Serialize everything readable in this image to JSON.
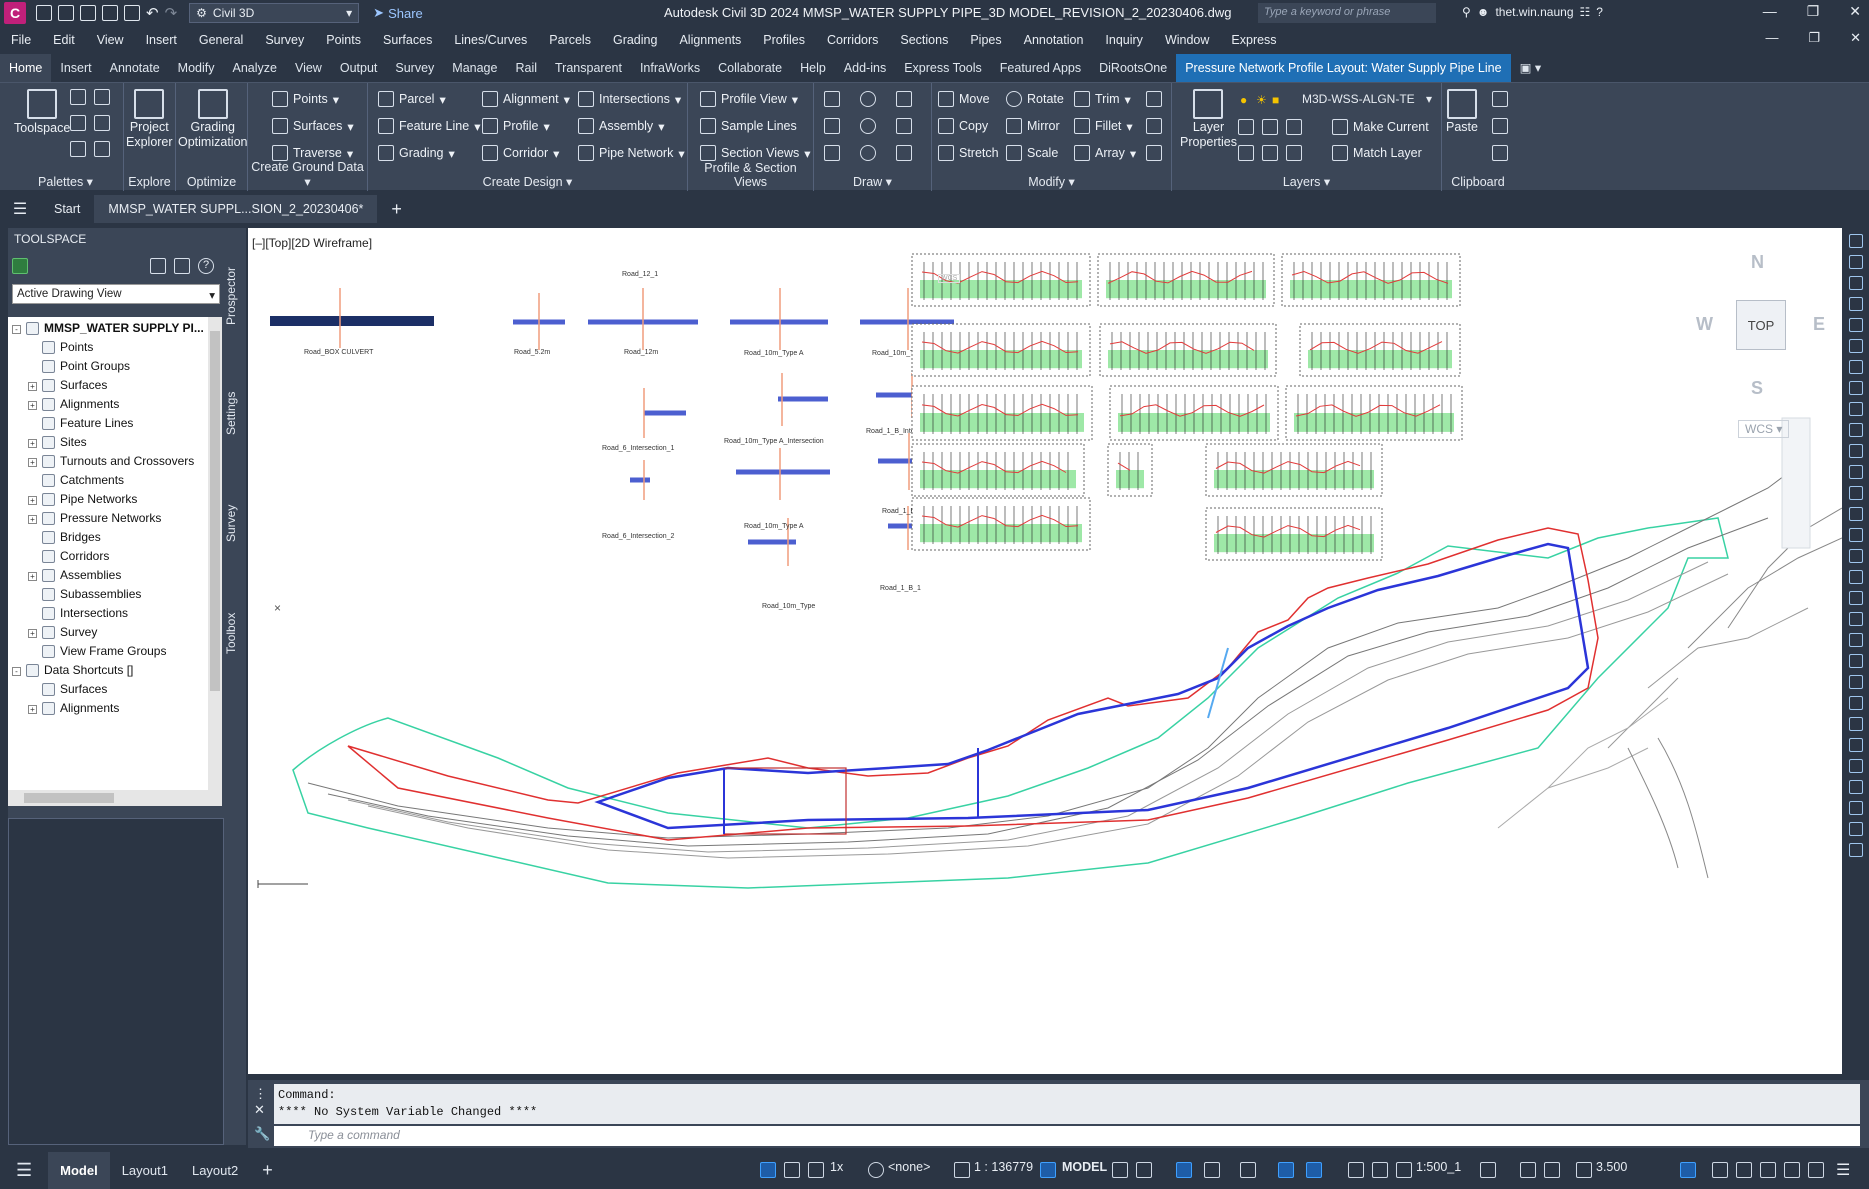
{
  "titlebar": {
    "app_logo": "C",
    "workspace": "Civil 3D",
    "share": "Share",
    "title": "Autodesk Civil 3D 2024   MMSP_WATER SUPPLY PIPE_3D MODEL_REVISION_2_20230406.dwg",
    "search_placeholder": "Type a keyword or phrase",
    "user": "thet.win.naung"
  },
  "menubar": [
    "File",
    "Edit",
    "View",
    "Insert",
    "General",
    "Survey",
    "Points",
    "Surfaces",
    "Lines/Curves",
    "Parcels",
    "Grading",
    "Alignments",
    "Profiles",
    "Corridors",
    "Sections",
    "Pipes",
    "Annotation",
    "Inquiry",
    "Window",
    "Express"
  ],
  "ribbon_tabs": [
    "Home",
    "Insert",
    "Annotate",
    "Modify",
    "Analyze",
    "View",
    "Output",
    "Survey",
    "Manage",
    "Rail",
    "Transparent",
    "InfraWorks",
    "Collaborate",
    "Help",
    "Add-ins",
    "Express Tools",
    "Featured Apps",
    "DiRootsOne"
  ],
  "ribbon_context_tab": "Pressure Network Profile Layout: Water Supply Pipe Line",
  "ribbon": {
    "palettes": {
      "title": "Palettes",
      "toolspace": "Toolspace"
    },
    "explore": {
      "title": "Explore",
      "project_explorer_1": "Project",
      "project_explorer_2": "Explorer"
    },
    "optimize": {
      "title": "Optimize",
      "grading_1": "Grading",
      "grading_2": "Optimization"
    },
    "ground": {
      "title": "Create Ground Data",
      "points": "Points",
      "surfaces": "Surfaces",
      "traverse": "Traverse"
    },
    "design": {
      "title": "Create Design",
      "parcel": "Parcel",
      "feature_line": "Feature Line",
      "grading": "Grading",
      "alignment": "Alignment",
      "profile": "Profile",
      "corridor": "Corridor",
      "intersections": "Intersections",
      "assembly": "Assembly",
      "pipe_network": "Pipe Network"
    },
    "profile_section": {
      "title": "Profile & Section Views",
      "profile_view": "Profile View",
      "sample_lines": "Sample Lines",
      "section_views": "Section Views"
    },
    "draw": {
      "title": "Draw"
    },
    "modify": {
      "title": "Modify",
      "move": "Move",
      "copy": "Copy",
      "stretch": "Stretch",
      "rotate": "Rotate",
      "mirror": "Mirror",
      "scale": "Scale",
      "trim": "Trim",
      "fillet": "Fillet",
      "array": "Array"
    },
    "layers": {
      "title": "Layers",
      "layer_props_1": "Layer",
      "layer_props_2": "Properties",
      "current_layer": "M3D-WSS-ALGN-TE",
      "make_current": "Make Current",
      "match_layer": "Match Layer"
    },
    "clipboard": {
      "title": "Clipboard",
      "paste": "Paste"
    }
  },
  "file_tabs": {
    "start": "Start",
    "doc": "MMSP_WATER SUPPL...SION_2_20230406*"
  },
  "toolspace": {
    "title": "TOOLSPACE",
    "view_select": "Active Drawing View",
    "tree": [
      {
        "label": "MMSP_WATER SUPPLY PI...",
        "level": 0,
        "exp": "-",
        "bold": true
      },
      {
        "label": "Points",
        "level": 1,
        "exp": ""
      },
      {
        "label": "Point Groups",
        "level": 1,
        "exp": ""
      },
      {
        "label": "Surfaces",
        "level": 1,
        "exp": "+"
      },
      {
        "label": "Alignments",
        "level": 1,
        "exp": "+"
      },
      {
        "label": "Feature Lines",
        "level": 1,
        "exp": ""
      },
      {
        "label": "Sites",
        "level": 1,
        "exp": "+"
      },
      {
        "label": "Turnouts and Crossovers",
        "level": 1,
        "exp": "+"
      },
      {
        "label": "Catchments",
        "level": 1,
        "exp": ""
      },
      {
        "label": "Pipe Networks",
        "level": 1,
        "exp": "+"
      },
      {
        "label": "Pressure Networks",
        "level": 1,
        "exp": "+"
      },
      {
        "label": "Bridges",
        "level": 1,
        "exp": ""
      },
      {
        "label": "Corridors",
        "level": 1,
        "exp": ""
      },
      {
        "label": "Assemblies",
        "level": 1,
        "exp": "+"
      },
      {
        "label": "Subassemblies",
        "level": 1,
        "exp": ""
      },
      {
        "label": "Intersections",
        "level": 1,
        "exp": ""
      },
      {
        "label": "Survey",
        "level": 1,
        "exp": "+"
      },
      {
        "label": "View Frame Groups",
        "level": 1,
        "exp": ""
      },
      {
        "label": "Data Shortcuts []",
        "level": 0,
        "exp": "-"
      },
      {
        "label": "Surfaces",
        "level": 1,
        "exp": ""
      },
      {
        "label": "Alignments",
        "level": 1,
        "exp": "+"
      }
    ],
    "side_tabs": [
      "Prospector",
      "Settings",
      "Survey",
      "Toolbox"
    ]
  },
  "viewport": {
    "label": "[–][Top][2D Wireframe]",
    "compass": {
      "n": "N",
      "s": "S",
      "e": "E",
      "w": "W"
    },
    "cube_face": "TOP",
    "wcs": "WCS",
    "ucs_small": "WCS",
    "assembly_labels": [
      "Road_BOX CULVERT",
      "Road_5.2m",
      "Road_12_1",
      "Road_12m",
      "Road_10m_Type A",
      "Road_10m_Type B",
      "Road_6_Intersection_1",
      "Road_10m_Type A_Intersection",
      "Road_1_B_Intersection",
      "Road_6_Intersection_2",
      "Road_10m_Type A",
      "Road_1_B",
      "Road_10m_Type",
      "Road_1_B_1"
    ]
  },
  "command": {
    "line1": "Command:",
    "line2": "**** No System Variable Changed ****",
    "placeholder": "Type a command"
  },
  "status": {
    "layouts": [
      "Model",
      "Layout1",
      "Layout2"
    ],
    "scale_1x": "1x",
    "none": "<none>",
    "ratio": "1 : 136779",
    "model": "MODEL",
    "annoscale": "1:500_1",
    "value": "3.500"
  }
}
